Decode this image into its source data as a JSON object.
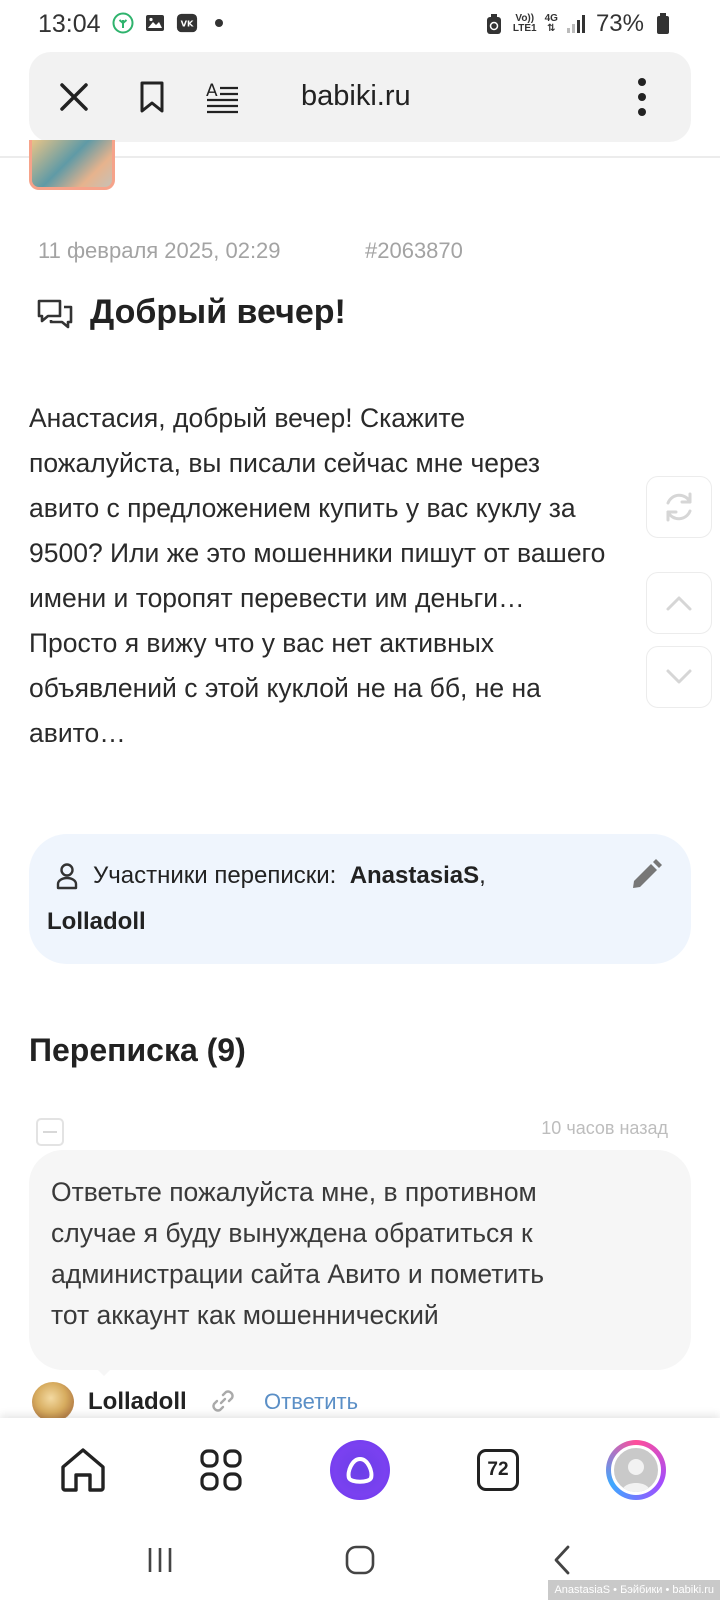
{
  "status_bar": {
    "time": "13:04",
    "volte_top": "Vo))",
    "volte_bottom": "LTE1",
    "network": "4G",
    "battery": "73%",
    "icons": [
      "eco-icon",
      "gallery-icon",
      "vk-icon",
      "dot-icon",
      "recycle-icon",
      "signal-icon",
      "battery-icon"
    ]
  },
  "browser": {
    "url": "babiki.ru",
    "icons": [
      "close-icon",
      "bookmark-icon",
      "reader-mode-icon",
      "more-vertical-icon"
    ]
  },
  "post": {
    "date": "11 февраля 2025, 02:29",
    "id": "#2063870",
    "title": "Добрый вечер!",
    "body_lines": [
      "Анастасия, добрый вечер! Скажите",
      "пожалуйста, вы писали сейчас мне через",
      "авито с предложением купить у вас куклу за",
      "9500? Или же это мошенники пишут от вашего",
      "имени и торопят перевести им деньги…",
      "Просто я вижу что у вас нет активных",
      "объявлений с этой куклой не на бб, не на",
      "авито…"
    ]
  },
  "participants": {
    "label": "Участники переписки:",
    "user1": "AnastasiaS",
    "separator": ",",
    "user2": "Lolladoll"
  },
  "thread": {
    "title": "Переписка (9)",
    "message": {
      "time_ago": "10 часов назад",
      "lines": [
        "Ответьте пожалуйста мне, в противном",
        "случае я буду вынуждена обратиться к",
        "администрации сайта Авито и пометить",
        "тот аккаунт как мошеннический"
      ],
      "author": "Lolladoll",
      "reply_label": "Ответить"
    }
  },
  "bottom_nav": {
    "messages_count": "72",
    "icons": [
      "home-icon",
      "grid-icon",
      "alice-icon",
      "messages-icon",
      "profile-icon"
    ]
  },
  "watermark": "AnastasiaS • Бэйбики • babiki.ru",
  "colors": {
    "participants_bg": "#eff5fd",
    "link": "#5b8fc6",
    "alice": "#6b3fe8",
    "meta": "#a3a3a3"
  }
}
